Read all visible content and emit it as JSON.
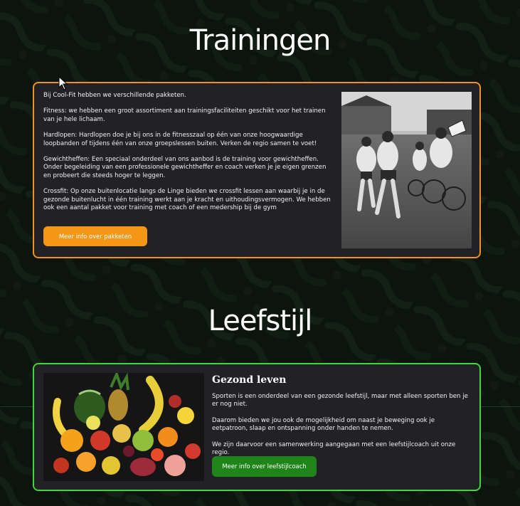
{
  "trainingen": {
    "title": "Trainingen",
    "paragraphs": [
      "Bij Cool-Fit hebben we verschillende pakketen.",
      "Fitness: we hebben een groot assortiment aan trainingsfaciliteiten geschikt voor het trainen van je hele lichaam.",
      "Hardlopen: Hardlopen doe je bij ons in de fitnesszaal op één van onze hoogwaardige loopbanden of tijdens één van onze groepslessen buiten. Verken de regio samen te voet!",
      "Gewichtheffen: Een speciaal onderdeel van ons aanbod is de training voor gewichtheffen. Onder begeleiding van een professionele gewichtheffer en coach verken je je eigen grenzen en probeert die steeds hoger te leggen.",
      "Crossfit: Op onze buitenlocatie langs de Linge bieden we crossfit lessen aan waarbij je in de gezonde buitenlucht in één training werkt aan je kracht en uithoudingsvermogen. We hebben ook een aantal pakket voor training met coach of een medership bij de gym"
    ],
    "button_label": "Meer info over pakketen",
    "accent_color": "#f39714",
    "image_icon": "runners-photo"
  },
  "leefstijl": {
    "title": "Leefstijl",
    "heading": "Gezond leven",
    "paragraphs": [
      "Sporten is een onderdeel van een gezonde leefstijl, maar met alleen sporten ben je er nog niet.",
      "Daarom bieden we jou ook de mogelijkheid om naast je beweging ook je eetpatroon, slaap en ontspanning onder handen te nemen.",
      "We zijn daarvoor een samenwerking aangegaan met een leefstijlcoach uit onze regio."
    ],
    "button_label": "Meer info over leefstijlcoach",
    "accent_color": "#3fd83a",
    "image_icon": "fruit-photo"
  },
  "background_color": "#0c140e"
}
